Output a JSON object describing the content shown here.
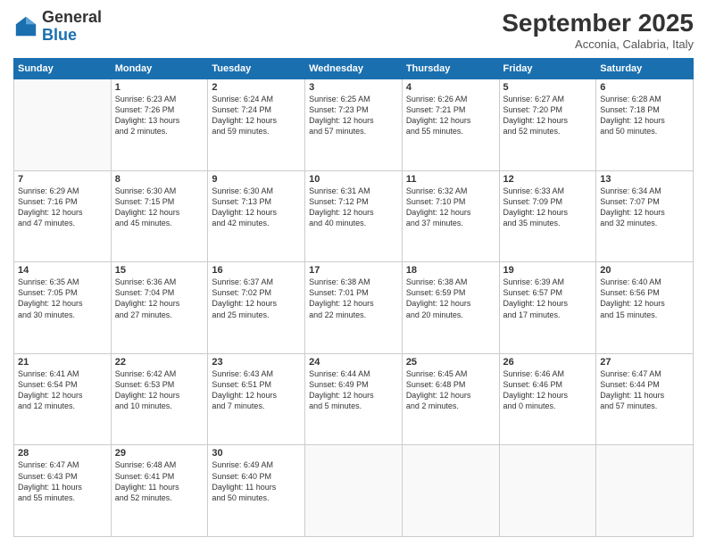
{
  "logo": {
    "general": "General",
    "blue": "Blue"
  },
  "header": {
    "month": "September 2025",
    "location": "Acconia, Calabria, Italy"
  },
  "weekdays": [
    "Sunday",
    "Monday",
    "Tuesday",
    "Wednesday",
    "Thursday",
    "Friday",
    "Saturday"
  ],
  "weeks": [
    [
      {
        "day": "",
        "info": ""
      },
      {
        "day": "1",
        "info": "Sunrise: 6:23 AM\nSunset: 7:26 PM\nDaylight: 13 hours\nand 2 minutes."
      },
      {
        "day": "2",
        "info": "Sunrise: 6:24 AM\nSunset: 7:24 PM\nDaylight: 12 hours\nand 59 minutes."
      },
      {
        "day": "3",
        "info": "Sunrise: 6:25 AM\nSunset: 7:23 PM\nDaylight: 12 hours\nand 57 minutes."
      },
      {
        "day": "4",
        "info": "Sunrise: 6:26 AM\nSunset: 7:21 PM\nDaylight: 12 hours\nand 55 minutes."
      },
      {
        "day": "5",
        "info": "Sunrise: 6:27 AM\nSunset: 7:20 PM\nDaylight: 12 hours\nand 52 minutes."
      },
      {
        "day": "6",
        "info": "Sunrise: 6:28 AM\nSunset: 7:18 PM\nDaylight: 12 hours\nand 50 minutes."
      }
    ],
    [
      {
        "day": "7",
        "info": "Sunrise: 6:29 AM\nSunset: 7:16 PM\nDaylight: 12 hours\nand 47 minutes."
      },
      {
        "day": "8",
        "info": "Sunrise: 6:30 AM\nSunset: 7:15 PM\nDaylight: 12 hours\nand 45 minutes."
      },
      {
        "day": "9",
        "info": "Sunrise: 6:30 AM\nSunset: 7:13 PM\nDaylight: 12 hours\nand 42 minutes."
      },
      {
        "day": "10",
        "info": "Sunrise: 6:31 AM\nSunset: 7:12 PM\nDaylight: 12 hours\nand 40 minutes."
      },
      {
        "day": "11",
        "info": "Sunrise: 6:32 AM\nSunset: 7:10 PM\nDaylight: 12 hours\nand 37 minutes."
      },
      {
        "day": "12",
        "info": "Sunrise: 6:33 AM\nSunset: 7:09 PM\nDaylight: 12 hours\nand 35 minutes."
      },
      {
        "day": "13",
        "info": "Sunrise: 6:34 AM\nSunset: 7:07 PM\nDaylight: 12 hours\nand 32 minutes."
      }
    ],
    [
      {
        "day": "14",
        "info": "Sunrise: 6:35 AM\nSunset: 7:05 PM\nDaylight: 12 hours\nand 30 minutes."
      },
      {
        "day": "15",
        "info": "Sunrise: 6:36 AM\nSunset: 7:04 PM\nDaylight: 12 hours\nand 27 minutes."
      },
      {
        "day": "16",
        "info": "Sunrise: 6:37 AM\nSunset: 7:02 PM\nDaylight: 12 hours\nand 25 minutes."
      },
      {
        "day": "17",
        "info": "Sunrise: 6:38 AM\nSunset: 7:01 PM\nDaylight: 12 hours\nand 22 minutes."
      },
      {
        "day": "18",
        "info": "Sunrise: 6:38 AM\nSunset: 6:59 PM\nDaylight: 12 hours\nand 20 minutes."
      },
      {
        "day": "19",
        "info": "Sunrise: 6:39 AM\nSunset: 6:57 PM\nDaylight: 12 hours\nand 17 minutes."
      },
      {
        "day": "20",
        "info": "Sunrise: 6:40 AM\nSunset: 6:56 PM\nDaylight: 12 hours\nand 15 minutes."
      }
    ],
    [
      {
        "day": "21",
        "info": "Sunrise: 6:41 AM\nSunset: 6:54 PM\nDaylight: 12 hours\nand 12 minutes."
      },
      {
        "day": "22",
        "info": "Sunrise: 6:42 AM\nSunset: 6:53 PM\nDaylight: 12 hours\nand 10 minutes."
      },
      {
        "day": "23",
        "info": "Sunrise: 6:43 AM\nSunset: 6:51 PM\nDaylight: 12 hours\nand 7 minutes."
      },
      {
        "day": "24",
        "info": "Sunrise: 6:44 AM\nSunset: 6:49 PM\nDaylight: 12 hours\nand 5 minutes."
      },
      {
        "day": "25",
        "info": "Sunrise: 6:45 AM\nSunset: 6:48 PM\nDaylight: 12 hours\nand 2 minutes."
      },
      {
        "day": "26",
        "info": "Sunrise: 6:46 AM\nSunset: 6:46 PM\nDaylight: 12 hours\nand 0 minutes."
      },
      {
        "day": "27",
        "info": "Sunrise: 6:47 AM\nSunset: 6:44 PM\nDaylight: 11 hours\nand 57 minutes."
      }
    ],
    [
      {
        "day": "28",
        "info": "Sunrise: 6:47 AM\nSunset: 6:43 PM\nDaylight: 11 hours\nand 55 minutes."
      },
      {
        "day": "29",
        "info": "Sunrise: 6:48 AM\nSunset: 6:41 PM\nDaylight: 11 hours\nand 52 minutes."
      },
      {
        "day": "30",
        "info": "Sunrise: 6:49 AM\nSunset: 6:40 PM\nDaylight: 11 hours\nand 50 minutes."
      },
      {
        "day": "",
        "info": ""
      },
      {
        "day": "",
        "info": ""
      },
      {
        "day": "",
        "info": ""
      },
      {
        "day": "",
        "info": ""
      }
    ]
  ]
}
